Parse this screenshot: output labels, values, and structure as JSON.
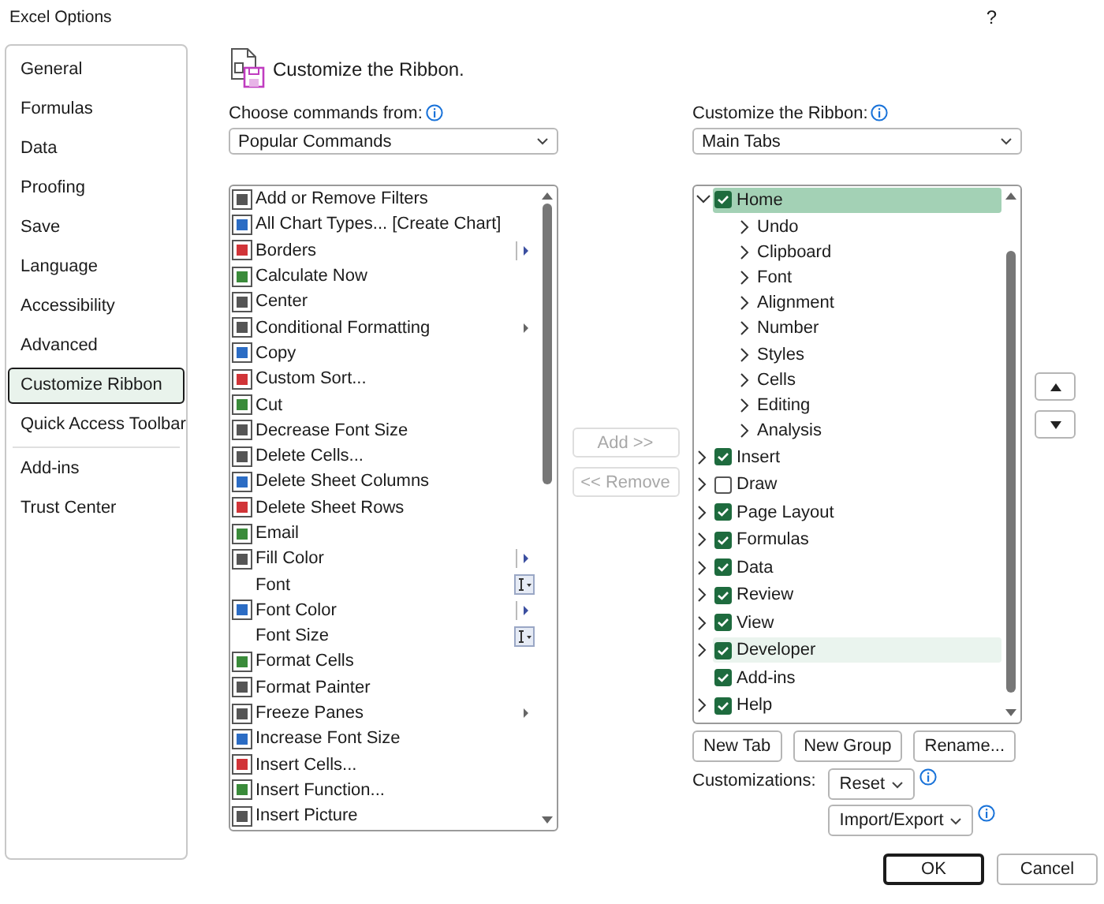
{
  "window": {
    "title": "Excel Options",
    "help": "?"
  },
  "sidebar": {
    "items": [
      {
        "label": "General",
        "selected": false
      },
      {
        "label": "Formulas",
        "selected": false
      },
      {
        "label": "Data",
        "selected": false
      },
      {
        "label": "Proofing",
        "selected": false
      },
      {
        "label": "Save",
        "selected": false
      },
      {
        "label": "Language",
        "selected": false
      },
      {
        "label": "Accessibility",
        "selected": false
      },
      {
        "label": "Advanced",
        "selected": false
      },
      {
        "label": "Customize Ribbon",
        "selected": true
      },
      {
        "label": "Quick Access Toolbar",
        "selected": false
      },
      {
        "kind": "separator"
      },
      {
        "label": "Add-ins",
        "selected": false
      },
      {
        "label": "Trust Center",
        "selected": false
      }
    ]
  },
  "heading": "Customize the Ribbon.",
  "commands_source": {
    "label": "Choose commands from:",
    "value": "Popular Commands"
  },
  "commands": [
    {
      "label": "Add or Remove Filters",
      "kind": "plain"
    },
    {
      "label": "All Chart Types... [Create Chart]",
      "kind": "plain"
    },
    {
      "label": "Borders",
      "kind": "split"
    },
    {
      "label": "Calculate Now",
      "kind": "plain"
    },
    {
      "label": "Center",
      "kind": "plain"
    },
    {
      "label": "Conditional Formatting",
      "kind": "menu"
    },
    {
      "label": "Copy",
      "kind": "plain"
    },
    {
      "label": "Custom Sort...",
      "kind": "plain"
    },
    {
      "label": "Cut",
      "kind": "plain"
    },
    {
      "label": "Decrease Font Size",
      "kind": "plain"
    },
    {
      "label": "Delete Cells...",
      "kind": "plain"
    },
    {
      "label": "Delete Sheet Columns",
      "kind": "plain"
    },
    {
      "label": "Delete Sheet Rows",
      "kind": "plain"
    },
    {
      "label": "Email",
      "kind": "plain"
    },
    {
      "label": "Fill Color",
      "kind": "split"
    },
    {
      "label": "Font",
      "kind": "field"
    },
    {
      "label": "Font Color",
      "kind": "split"
    },
    {
      "label": "Font Size",
      "kind": "field"
    },
    {
      "label": "Format Cells",
      "kind": "plain"
    },
    {
      "label": "Format Painter",
      "kind": "plain"
    },
    {
      "label": "Freeze Panes",
      "kind": "menu"
    },
    {
      "label": "Increase Font Size",
      "kind": "plain"
    },
    {
      "label": "Insert Cells...",
      "kind": "plain"
    },
    {
      "label": "Insert Function...",
      "kind": "plain"
    },
    {
      "label": "Insert Picture",
      "kind": "plain"
    }
  ],
  "transfer_buttons": [
    {
      "label": "Add >>",
      "disabled": true
    },
    {
      "label": "<< Remove",
      "disabled": true
    }
  ],
  "ribbon_source": {
    "label": "Customize the Ribbon:",
    "value": "Main Tabs"
  },
  "ribbon_tabs": [
    {
      "label": "Home",
      "checked": true,
      "expanded": true,
      "selected": true,
      "hovered": false,
      "children": [
        {
          "label": "Undo"
        },
        {
          "label": "Clipboard"
        },
        {
          "label": "Font"
        },
        {
          "label": "Alignment"
        },
        {
          "label": "Number"
        },
        {
          "label": "Styles"
        },
        {
          "label": "Cells"
        },
        {
          "label": "Editing"
        },
        {
          "label": "Analysis"
        }
      ]
    },
    {
      "label": "Insert",
      "checked": true,
      "expanded": false,
      "selected": false,
      "hovered": false
    },
    {
      "label": "Draw",
      "checked": false,
      "expanded": false,
      "selected": false,
      "hovered": false
    },
    {
      "label": "Page Layout",
      "checked": true,
      "expanded": false,
      "selected": false,
      "hovered": false
    },
    {
      "label": "Formulas",
      "checked": true,
      "expanded": false,
      "selected": false,
      "hovered": false
    },
    {
      "label": "Data",
      "checked": true,
      "expanded": false,
      "selected": false,
      "hovered": false
    },
    {
      "label": "Review",
      "checked": true,
      "expanded": false,
      "selected": false,
      "hovered": false
    },
    {
      "label": "View",
      "checked": true,
      "expanded": false,
      "selected": false,
      "hovered": false
    },
    {
      "label": "Developer",
      "checked": true,
      "expanded": false,
      "selected": false,
      "hovered": true
    },
    {
      "label": "Add-ins",
      "checked": true,
      "selected": false,
      "hovered": false,
      "kind": "leaf"
    },
    {
      "label": "Help",
      "checked": true,
      "expanded": false,
      "selected": false,
      "hovered": false
    }
  ],
  "ribbon_buttons": [
    {
      "label": "New Tab"
    },
    {
      "label": "New Group"
    },
    {
      "label": "Rename..."
    }
  ],
  "customizations": {
    "label": "Customizations:",
    "reset": "Reset",
    "import_export": "Import/Export"
  },
  "dialog_buttons": [
    {
      "label": "OK",
      "default": true
    },
    {
      "label": "Cancel",
      "default": false
    }
  ]
}
